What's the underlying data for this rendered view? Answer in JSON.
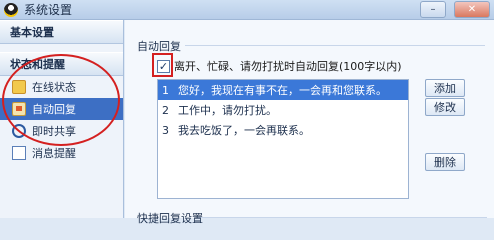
{
  "window": {
    "title": "系统设置",
    "min_label": "–",
    "close_label": "✕"
  },
  "sidebar": {
    "header1": "基本设置",
    "header2": "状态和提醒",
    "items": [
      {
        "label": "在线状态",
        "icon": "online-status-icon"
      },
      {
        "label": "自动回复",
        "icon": "auto-reply-icon",
        "active": true
      },
      {
        "label": "即时共享",
        "icon": "share-icon"
      },
      {
        "label": "消息提醒",
        "icon": "message-alert-icon"
      }
    ]
  },
  "main": {
    "group_title": "自动回复",
    "checkbox_label": "离开、忙碌、请勿打扰时自动回复(100字以内)",
    "checkbox_checked": true,
    "replies": [
      {
        "num": "1",
        "text": "您好，我现在有事不在，一会再和您联系。",
        "selected": true
      },
      {
        "num": "2",
        "text": "工作中，请勿打扰。"
      },
      {
        "num": "3",
        "text": "我去吃饭了，一会再联系。"
      }
    ],
    "buttons": {
      "add": "添加",
      "edit": "修改",
      "delete": "删除"
    },
    "bottom_group_title": "快捷回复设置"
  },
  "colors": {
    "selection": "#3b78d8",
    "annotation": "#d42020"
  }
}
